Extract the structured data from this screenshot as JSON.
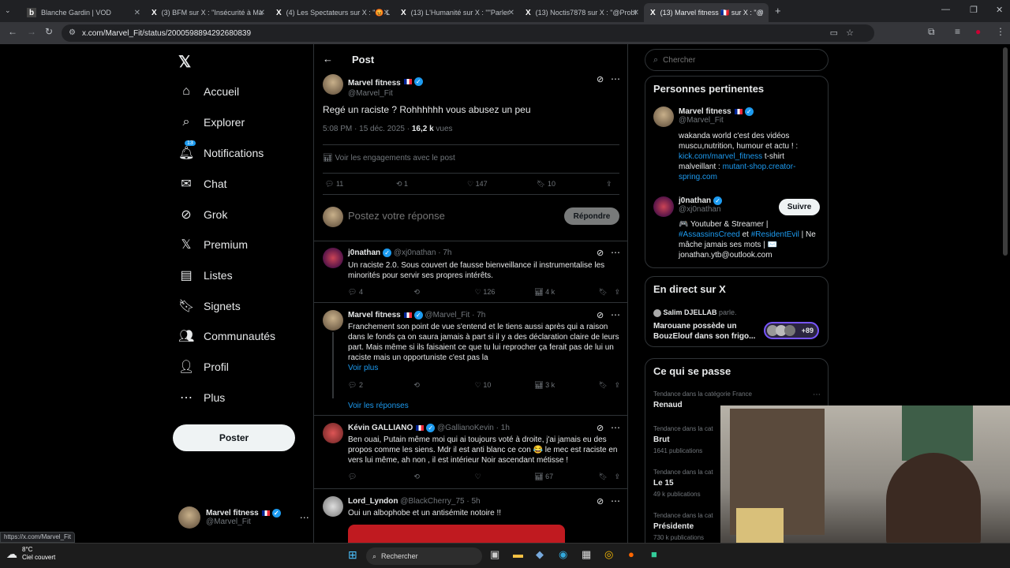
{
  "browser": {
    "tabs": [
      {
        "label": "Blanche Gardin | VOD",
        "icon": "b"
      },
      {
        "label": "(3) BFM sur X : \"Insécurité à Ma",
        "icon": "X"
      },
      {
        "label": "(4) Les Spectateurs sur X : \"😡 L",
        "icon": "X"
      },
      {
        "label": "(13) L'Humanité sur X : \"\"Parler",
        "icon": "X"
      },
      {
        "label": "(13) Noctis7878 sur X : \"@Probl",
        "icon": "X"
      },
      {
        "label": "(13) Marvel fitness 🇫🇷 sur X : \"@",
        "icon": "X"
      }
    ],
    "url": "x.com/Marvel_Fit/status/2000598894292680839",
    "status_url": "https://x.com/Marvel_Fit"
  },
  "nav": {
    "items": [
      {
        "label": "Accueil",
        "icon": "home-icon"
      },
      {
        "label": "Explorer",
        "icon": "search-icon"
      },
      {
        "label": "Notifications",
        "icon": "bell-icon",
        "badge": "13"
      },
      {
        "label": "Chat",
        "icon": "mail-icon"
      },
      {
        "label": "Grok",
        "icon": "grok-icon"
      },
      {
        "label": "Premium",
        "icon": "x-logo-icon"
      },
      {
        "label": "Listes",
        "icon": "list-icon"
      },
      {
        "label": "Signets",
        "icon": "bookmark-icon"
      },
      {
        "label": "Communautés",
        "icon": "people-icon"
      },
      {
        "label": "Profil",
        "icon": "person-icon"
      },
      {
        "label": "Plus",
        "icon": "more-icon"
      }
    ],
    "post_label": "Poster",
    "account_name": "Marvel fitness",
    "account_handle": "@Marvel_Fit"
  },
  "post": {
    "header": "Post",
    "author": "Marvel fitness",
    "handle": "@Marvel_Fit",
    "text": "Regé un raciste ? Rohhhhhh vous abusez un peu",
    "time": "5:08 PM · 15 déc. 2025 · ",
    "views_count": "16,2 k",
    "views_label": " vues",
    "engagements": "Voir les engagements avec le post",
    "replies": "11",
    "reposts": "1",
    "likes": "147",
    "bookmarks": "10",
    "reply_placeholder": "Postez votre réponse",
    "reply_button": "Répondre"
  },
  "replies": [
    {
      "name": "j0nathan",
      "handle": "@xj0nathan · 7h",
      "text": "Un raciste 2.0. Sous couvert de fausse bienveillance il instrumentalise les minorités pour servir ses propres intérêts.",
      "replies": "4",
      "reposts": "",
      "likes": "126",
      "views": "4 k"
    },
    {
      "name": "Marvel fitness",
      "handle": "@Marvel_Fit · 7h",
      "text": "Franchement son point de vue s'entend et le tiens aussi après qui a raison dans le fonds ça on saura jamais à part si il y a des déclaration claire de leurs part. Mais même si  ils faisaient ce que tu lui reprocher ça ferait pas de lui un raciste mais un opportuniste c'est pas la",
      "more": "Voir plus",
      "replies": "2",
      "reposts": "",
      "likes": "10",
      "views": "3 k",
      "see_replies": "Voir les réponses"
    },
    {
      "name": "Kévin GALLIANO",
      "handle": "@GallianoKevin · 1h",
      "text": "Ben ouai, Putain même moi qui ai toujours voté à droite, j'ai jamais eu des propos comme les siens. Mdr il est anti blanc ce con 😂 le mec est raciste en vers lui même, ah non , il est intérieur Noir ascendant métisse !",
      "replies": "",
      "reposts": "",
      "likes": "",
      "views": "67"
    },
    {
      "name": "Lord_Lyndon",
      "handle": "@BlackCherry_75 · 5h",
      "text": "Oui un albophobe et un antisémite notoire !!"
    }
  ],
  "right": {
    "search_placeholder": "Chercher",
    "relevant_title": "Personnes pertinentes",
    "person1": {
      "name": "Marvel fitness",
      "handle": "@Marvel_Fit",
      "bio_a": "wakanda world c'est des vidéos muscu,nutrition, humour et actu ! :",
      "link1": "kick.com/marvel_fitness",
      "bio_b": " t-shirt malveillant : ",
      "link2": "mutant-shop.creator-spring.com"
    },
    "person2": {
      "name": "j0nathan",
      "handle": "@xj0nathan",
      "follow": "Suivre",
      "bio_a": "🎮 Youtuber & Streamer | ",
      "tag1": "#AssassinsCreed",
      "bio_b": " et ",
      "tag2": "#ResidentEvil",
      "bio_c": " | Ne mâche jamais ses mots | ✉️ jonathan.ytb@outlook.com"
    },
    "live_title": "En direct sur X",
    "live_host": "Salim DJELLAB",
    "live_host_suffix": " parle.",
    "live_text": "Marouane possède un BouzElouf dans son frigo...",
    "live_count": "+89",
    "trends_title": "Ce qui se passe",
    "trends": [
      {
        "meta": "Tendance dans la catégorie France",
        "name": "Renaud",
        "count": ""
      },
      {
        "meta": "Tendance dans la cat",
        "name": "Brut",
        "count": "1641 publications"
      },
      {
        "meta": "Tendance dans la cat",
        "name": "Le 15",
        "count": "49 k publications"
      },
      {
        "meta": "Tendance dans la cat",
        "name": "Présidente",
        "count": "730 k publications"
      }
    ]
  },
  "taskbar": {
    "temp": "8°C",
    "weather": "Ciel couvert",
    "search": "Rechercher"
  }
}
